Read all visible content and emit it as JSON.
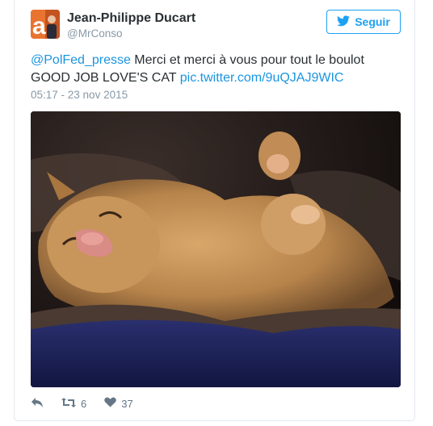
{
  "tweet": {
    "author_name": "Jean-Philippe Ducart",
    "author_handle": "@MrConso",
    "follow_label": "Seguir",
    "mention": "@PolFed_presse",
    "text_part1": " Merci et merci à vous pour tout le boulot",
    "text_part2": "GOOD JOB LOVE'S CAT ",
    "pic_link": "pic.twitter.com/9uQJAJ9WIC",
    "timestamp": "05:17 - 23 nov 2015"
  },
  "actions": {
    "retweets": "6",
    "likes": "37"
  },
  "icons": {
    "follow": "twitter-bird-icon",
    "reply": "reply-icon",
    "retweet": "retweet-icon",
    "like": "heart-icon"
  },
  "colors": {
    "accent": "#1da1f2",
    "link": "#1b95e0",
    "muted": "#8899a6",
    "text": "#292f33"
  }
}
